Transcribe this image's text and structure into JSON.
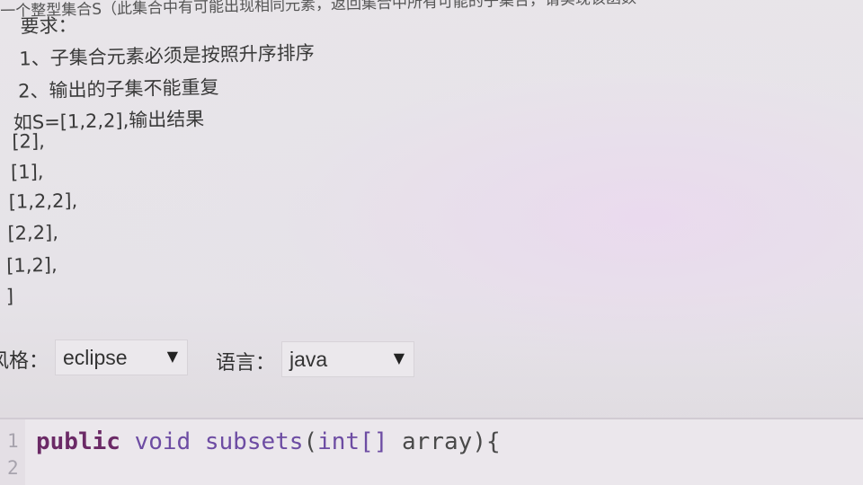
{
  "problem": {
    "top_line": "一个整型集合S（此集合中有可能出现相同元素，返回集合中所有可能的子集合，请实现该函数",
    "requirements_heading": "要求：",
    "rules": [
      "1、子集合元素必须是按照升序排序",
      "2、输出的子集不能重复"
    ],
    "example_intro": "如S=[1,2,2],输出结果",
    "output_lines": [
      "[2],",
      "[1],",
      "[1,2,2],",
      "[2,2],",
      "[1,2],",
      "]"
    ]
  },
  "toolbar": {
    "style_label": "风格：",
    "style_value": "eclipse",
    "language_label": "语言：",
    "language_value": "java"
  },
  "editor": {
    "line_numbers": [
      "1",
      "2"
    ],
    "code": {
      "keyword": "public",
      "return_type": "void",
      "method_name": "subsets",
      "open_paren": "(",
      "param_type": "int[]",
      "param_name": "array",
      "close": "){"
    }
  },
  "colors": {
    "background": "#e9e6ea",
    "keyword": "#6b2a66",
    "type_keyword": "#6d4ca3",
    "line_number": "#a7a3ad"
  }
}
